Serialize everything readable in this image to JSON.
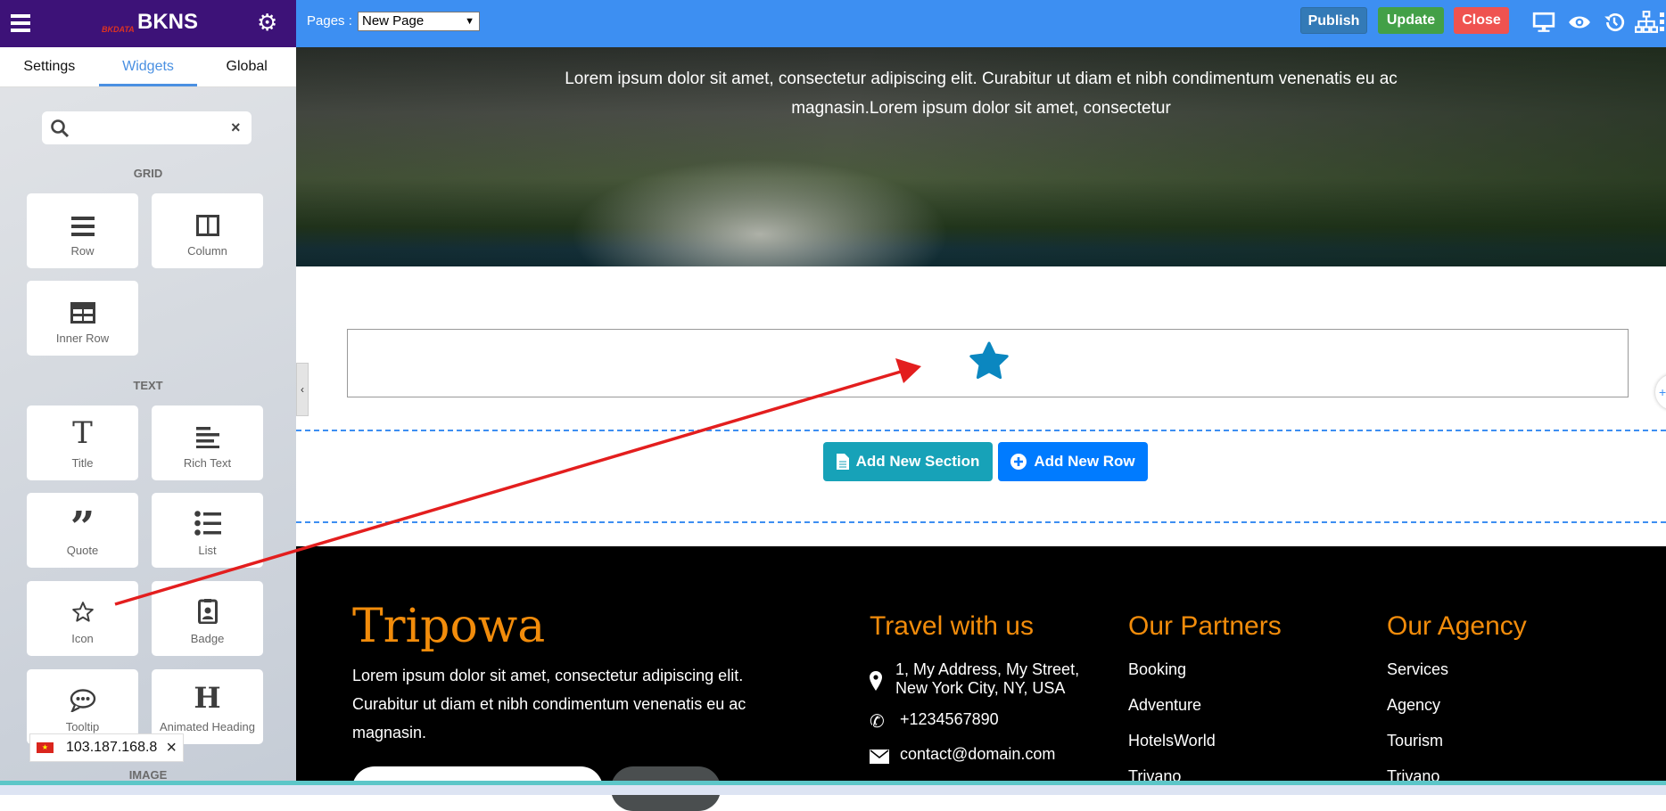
{
  "sidebar": {
    "brand": "BKNS",
    "brand_sub": "BKDATA",
    "tabs": [
      {
        "label": "Settings"
      },
      {
        "label": "Widgets"
      },
      {
        "label": "Global"
      }
    ],
    "search": {
      "value": "",
      "placeholder": ""
    },
    "sections": {
      "grid": "GRID",
      "text": "TEXT",
      "image": "IMAGE"
    },
    "grid_widgets": [
      {
        "label": "Row",
        "icon": "bars-icon"
      },
      {
        "label": "Column",
        "icon": "columns-icon"
      },
      {
        "label": "Inner Row",
        "icon": "table-icon"
      }
    ],
    "text_widgets": [
      {
        "label": "Title",
        "icon": "title-icon"
      },
      {
        "label": "Rich Text",
        "icon": "align-left-icon"
      },
      {
        "label": "Quote",
        "icon": "quote-icon"
      },
      {
        "label": "List",
        "icon": "list-icon"
      },
      {
        "label": "Icon",
        "icon": "star-outline-icon"
      },
      {
        "label": "Badge",
        "icon": "badge-icon"
      },
      {
        "label": "Tooltip",
        "icon": "comment-icon"
      },
      {
        "label": "Animated Heading",
        "icon": "heading-icon"
      }
    ]
  },
  "ip_popup": {
    "ip": "103.187.168.8"
  },
  "topbar": {
    "pages_label": "Pages :",
    "page_selected": "New Page",
    "publish": "Publish",
    "update": "Update",
    "close": "Close",
    "colors": {
      "publish": "#337ab7",
      "update": "#43a047",
      "close": "#ef5350",
      "bar": "#3d8ff2"
    }
  },
  "hero": {
    "line1": "Lorem ipsum dolor sit amet, consectetur adipiscing elit. Curabitur ut diam et nibh condimentum venenatis eu ac",
    "line2": "magnasin.Lorem ipsum dolor sit amet, consectetur"
  },
  "canvas": {
    "icon_color": "#0b87c0",
    "add_section": "Add New Section",
    "add_row": "Add New Row"
  },
  "footer": {
    "brand": "Tripowa",
    "desc": [
      "Lorem ipsum dolor sit amet, consectetur adipiscing elit.",
      "Curabitur ut diam et nibh condimentum venenatis eu ac",
      "magnasin."
    ],
    "travel": {
      "title": "Travel with us",
      "address": [
        "1, My Address, My Street,",
        "New York City, NY, USA"
      ],
      "phone": "+1234567890",
      "email": "contact@domain.com"
    },
    "partners": {
      "title": "Our Partners",
      "items": [
        "Booking",
        "Adventure",
        "HotelsWorld",
        "Trivano"
      ]
    },
    "agency": {
      "title": "Our Agency",
      "items": [
        "Services",
        "Agency",
        "Tourism",
        "Trivano"
      ]
    }
  }
}
